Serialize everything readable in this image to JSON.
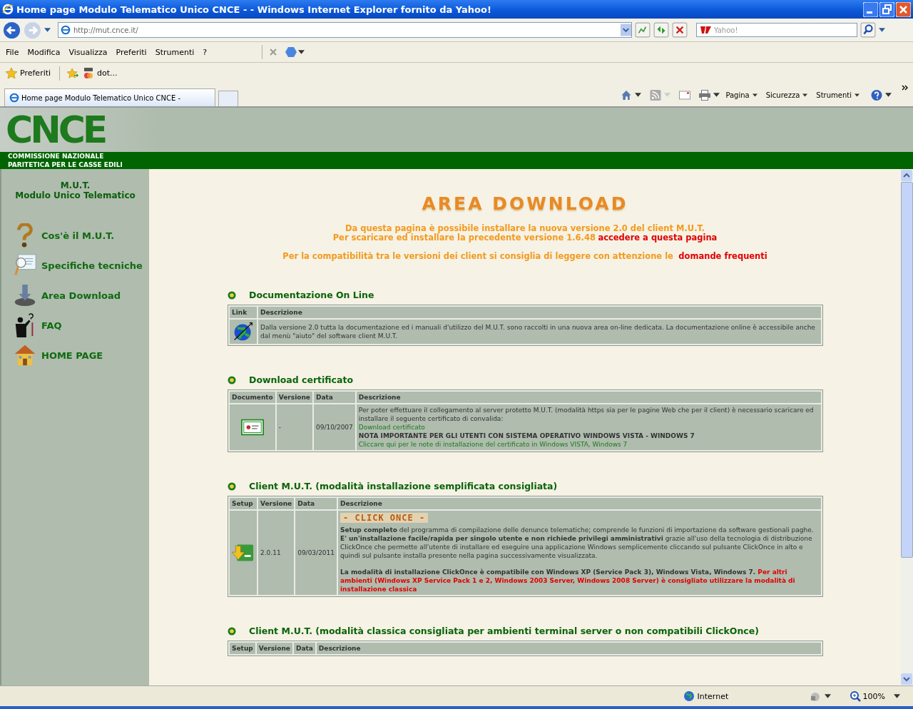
{
  "window": {
    "title": "Home page Modulo Telematico Unico CNCE - - Windows Internet Explorer fornito da Yahoo!"
  },
  "address_bar": {
    "url": "http://mut.cnce.it/",
    "search_placeholder": "Yahoo!"
  },
  "menu": [
    "File",
    "Modifica",
    "Visualizza",
    "Preferiti",
    "Strumenti",
    "?"
  ],
  "favorites_bar": {
    "favorites": "Preferiti",
    "links": [
      "dot..."
    ]
  },
  "tabs": [
    {
      "label": "Home page Modulo Telematico Unico CNCE -",
      "selected": true
    }
  ],
  "command_bar": [
    "Pagina",
    "Sicurezza",
    "Strumenti"
  ],
  "site": {
    "logo": "CNCE",
    "org_lines": [
      "COMMISSIONE NAZIONALE",
      "PARITETICA PER LE CASSE EDILI"
    ],
    "sidebar": {
      "title_lines": [
        "M.U.T.",
        "Modulo Unico Telematico"
      ],
      "items": [
        {
          "label": "Cos'è il M.U.T."
        },
        {
          "label": "Specifiche tecniche"
        },
        {
          "label": "Area Download"
        },
        {
          "label": "FAQ"
        },
        {
          "label": "HOME PAGE"
        }
      ]
    },
    "main": {
      "title": "AREA DOWNLOAD",
      "intro": [
        {
          "text": "Da questa pagina è possibile installare la nuova versione 2.0 del client M.U.T."
        },
        {
          "text": "Per scaricare ed installare la precedente versione 1.6.48",
          "link": "accedere a questa pagina"
        }
      ],
      "note": {
        "text": "Per la compatibilità tra le versioni dei client si consiglia di leggere con attenzione le",
        "link": "domande frequenti"
      },
      "sections": [
        {
          "title": "Documentazione On Line",
          "columns": [
            "Link",
            "Descrizione"
          ],
          "rows": [
            {
              "cells": [
                {
                  "kind": "icon"
                },
                {
                  "kind": "desc",
                  "lines": [
                    {
                      "kind": "text",
                      "text": "Dalla versione 2.0 tutta la documentazione ed i manuali d'utilizzo del M.U.T. sono raccolti in una nuova area on-line dedicata. La documentazione online è accessibile anche dal menù \"aiuto\" del software client M.U.T."
                    }
                  ]
                }
              ]
            }
          ]
        },
        {
          "title": "Download certificato",
          "columns": [
            "Documento",
            "Versione",
            "Data",
            "Descrizione"
          ],
          "rows": [
            {
              "cells": [
                {
                  "kind": "icon"
                },
                {
                  "kind": "text",
                  "text": "-"
                },
                {
                  "kind": "text",
                  "text": "09/10/2007"
                },
                {
                  "kind": "desc",
                  "lines": [
                    {
                      "kind": "text",
                      "text": "Per poter effettuare il collegamento al server protetto M.U.T. (modalità https sia per le pagine Web che per il client) è necessario scaricare ed installare il seguente certificato di convalida:"
                    },
                    {
                      "kind": "link",
                      "text": "Download certificato"
                    },
                    {
                      "kind": "strong",
                      "text": "NOTA IMPORTANTE PER GLI UTENTI CON SISTEMA OPERATIVO WINDOWS VISTA - WINDOWS 7"
                    },
                    {
                      "kind": "link",
                      "text": "Cliccare qui per le note di installazione del certificato in Windows VISTA, Windows 7"
                    }
                  ]
                }
              ]
            }
          ]
        },
        {
          "title": "Client M.U.T. (modalità installazione semplificata consigliata)",
          "columns": [
            "Setup",
            "Versione",
            "Data",
            "Descrizione"
          ],
          "rows": [
            {
              "cells": [
                {
                  "kind": "icon"
                },
                {
                  "kind": "text",
                  "text": "2.0.11"
                },
                {
                  "kind": "text",
                  "text": "09/03/2011"
                },
                {
                  "kind": "desc",
                  "lines": [
                    {
                      "kind": "banner",
                      "text": "- CLICK ONCE -"
                    },
                    {
                      "kind": "text",
                      "text": "**Setup completo** del programma di compilazione delle denunce telematiche; comprende le funzioni di importazione da software gestionali paghe."
                    },
                    {
                      "kind": "text",
                      "text": "**E' un'installazione facile/rapida per singolo utente e non richiede privilegi amministrativi** grazie all'uso della tecnologia di distribuzione ClickOnce che permette all'utente di installare ed eseguire una applicazione Windows semplicemente cliccando sul pulsante ClickOnce in alto e quindi sul pulsante installa presente nella pagina successivamente visualizzata."
                    },
                    {
                      "kind": "note",
                      "text": "La modalità di installazione ClickOnce è compatibile con Windows XP (Service Pack 3), Windows Vista, Windows 7.",
                      "alert": "Per altri ambienti (Windows XP Service Pack 1 e 2, Windows 2003 Server, Windows 2008 Server) è consigliato utilizzare la modalità di installazione classica"
                    }
                  ]
                }
              ]
            }
          ]
        },
        {
          "title": "Client M.U.T. (modalità classica consigliata per ambienti terminal server o non compatibili ClickOnce)",
          "columns": [
            "Setup",
            "Versione",
            "Data",
            "Descrizione"
          ]
        }
      ]
    }
  },
  "status_bar": {
    "zone": "Internet",
    "zoom": "100%"
  }
}
